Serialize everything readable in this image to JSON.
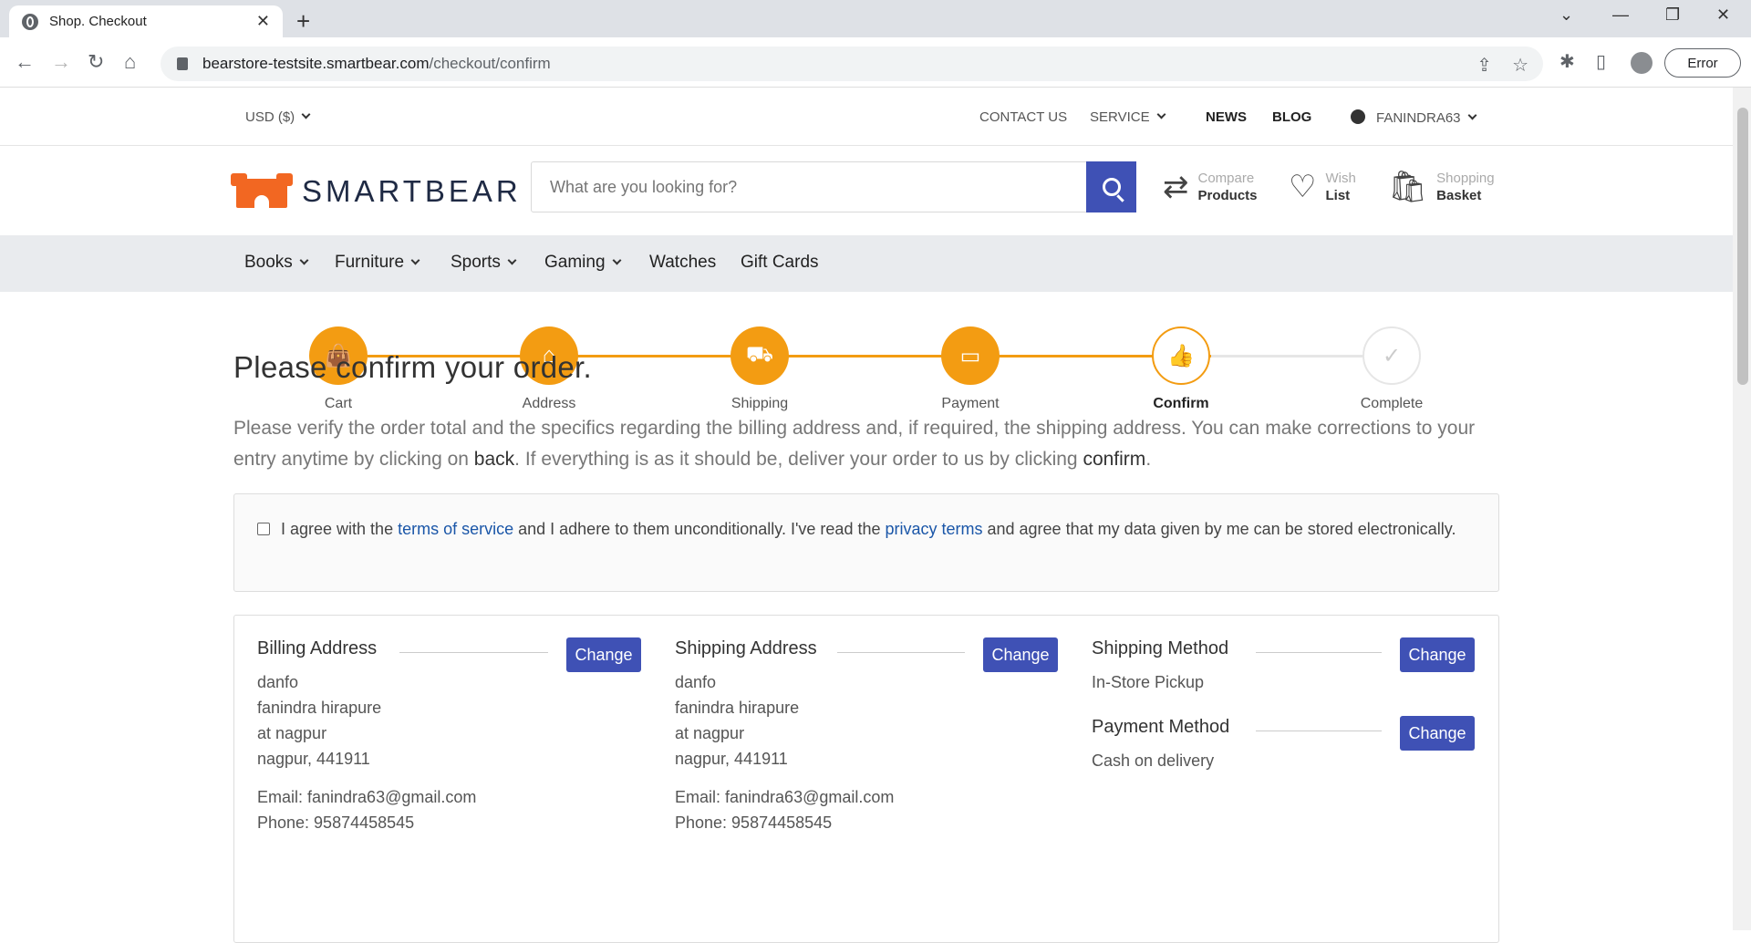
{
  "browser": {
    "tab_title": "Shop. Checkout",
    "url_host": "bearstore-testsite.smartbear.com",
    "url_path": "/checkout/confirm",
    "error_label": "Error"
  },
  "topbar": {
    "currency": "USD ($)",
    "contact": "CONTACT US",
    "service": "SERVICE",
    "news": "NEWS",
    "blog": "BLOG",
    "user": "FANINDRA63"
  },
  "header": {
    "brand": "SMARTBEAR",
    "search_placeholder": "What are you looking for?",
    "compare_top": "Compare",
    "compare_bottom": "Products",
    "wish_top": "Wish",
    "wish_bottom": "List",
    "basket_top": "Shopping",
    "basket_bottom": "Basket"
  },
  "categories": [
    "Books",
    "Furniture",
    "Sports",
    "Gaming",
    "Watches",
    "Gift Cards"
  ],
  "steps": [
    {
      "label": "Cart",
      "icon": "bag-icon"
    },
    {
      "label": "Address",
      "icon": "home-icon"
    },
    {
      "label": "Shipping",
      "icon": "truck-icon"
    },
    {
      "label": "Payment",
      "icon": "credit-card-icon"
    },
    {
      "label": "Confirm",
      "icon": "thumbs-up-icon"
    },
    {
      "label": "Complete",
      "icon": "check-icon"
    }
  ],
  "page": {
    "title": "Please confirm your order.",
    "intro_1": "Please verify the order total and the specifics regarding the billing address and, if required, the shipping address. You can make corrections to your entry anytime by clicking on ",
    "intro_back": "back",
    "intro_2": ". If everything is as it should be, deliver your order to us by clicking ",
    "intro_confirm": "confirm",
    "intro_3": "."
  },
  "terms": {
    "t1": "I agree with the ",
    "tos": "terms of service",
    "t2": " and I adhere to them unconditionally. I've read the ",
    "privacy": "privacy terms",
    "t3": " and agree that my data given by me can be stored electronically."
  },
  "billing": {
    "title": "Billing Address",
    "change": "Change",
    "company": "danfo",
    "name": "fanindra hirapure",
    "street": "at nagpur",
    "city": "nagpur, 441911",
    "email": "Email:  fanindra63@gmail.com",
    "phone": "Phone: 95874458545"
  },
  "shipping": {
    "title": "Shipping Address",
    "change": "Change",
    "company": "danfo",
    "name": "fanindra hirapure",
    "street": "at nagpur",
    "city": "nagpur, 441911",
    "email": "Email:  fanindra63@gmail.com",
    "phone": "Phone: 95874458545"
  },
  "shipping_method": {
    "title": "Shipping Method",
    "change": "Change",
    "value": "In-Store Pickup"
  },
  "payment_method": {
    "title": "Payment Method",
    "change": "Change",
    "value": "Cash on delivery"
  },
  "colors": {
    "accent": "#f39c12",
    "primary_button": "#3f51b5",
    "link": "#1a56a8"
  }
}
